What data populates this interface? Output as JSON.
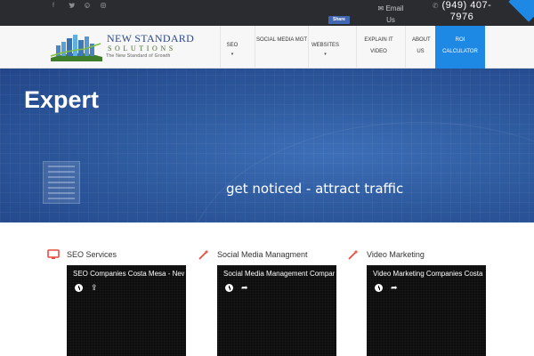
{
  "topbar": {
    "social": [
      "facebook-icon",
      "twitter-icon",
      "pinterest-icon",
      "instagram-icon"
    ],
    "email_label": "Email Us",
    "phone": "(949) 407-7976",
    "fb_share": "Share",
    "accent": "#1e88e5"
  },
  "logo": {
    "line1": "NEW STANDARD",
    "line2": "SOLUTIONS",
    "tagline": "The New Standard of Growth"
  },
  "nav": {
    "items": [
      {
        "label": "SEO",
        "dropdown": true
      },
      {
        "label": "SOCIAL MEDIA MGT",
        "dropdown": false
      },
      {
        "label": "WEBSITES",
        "dropdown": true
      },
      {
        "label": "EXPLAIN IT VIDEO",
        "dropdown": true
      },
      {
        "label": "ABOUT US",
        "dropdown": true
      }
    ],
    "roi": "ROI CALCULATOR"
  },
  "hero": {
    "title": "Expert",
    "subtitle": "get noticed - attract traffic"
  },
  "services": [
    {
      "title": "SEO Services",
      "icon": "monitor-icon",
      "video_title": "SEO Companies Costa Mesa - New"
    },
    {
      "title": "Social Media Managment",
      "icon": "magic-wand-icon",
      "video_title": "Social Media Management Compan"
    },
    {
      "title": "Video Marketing",
      "icon": "magic-wand-icon",
      "video_title": "Video Marketing Companies Costa"
    }
  ]
}
